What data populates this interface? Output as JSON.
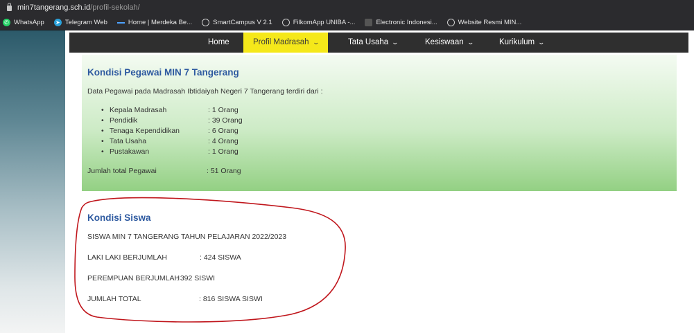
{
  "browser": {
    "url_host": "min7tangerang.sch.id",
    "url_path": "/profil-sekolah/",
    "bookmarks": [
      {
        "label": "WhatsApp",
        "icon": "whatsapp-icon"
      },
      {
        "label": "Telegram Web",
        "icon": "telegram-icon"
      },
      {
        "label": "Home | Merdeka Be...",
        "icon": "merdeka-icon"
      },
      {
        "label": "SmartCampus V 2.1",
        "icon": "globe-icon"
      },
      {
        "label": "FilkomApp UNIBA -...",
        "icon": "globe-icon"
      },
      {
        "label": "Electronic Indonesi...",
        "icon": "blank-page-icon"
      },
      {
        "label": "Website Resmi MIN...",
        "icon": "globe-icon"
      }
    ]
  },
  "nav": {
    "items": [
      {
        "label": "Home"
      },
      {
        "label": "Profil Madrasah",
        "active": true
      },
      {
        "label": "Tata Usaha"
      },
      {
        "label": "Kesiswaan"
      },
      {
        "label": "Kurikulum"
      }
    ],
    "active_color": "#f5e81a"
  },
  "pegawai": {
    "title": "Kondisi Pegawai MIN 7 Tangerang",
    "intro": "Data Pegawai pada Madrasah Ibtidaiyah Negeri 7 Tangerang terdiri dari :",
    "items": [
      {
        "label": "Kepala Madrasah",
        "value": ": 1 Orang"
      },
      {
        "label": "Pendidik",
        "value": ": 39 Orang"
      },
      {
        "label": "Tenaga Kependidikan",
        "value": ": 6 Orang"
      },
      {
        "label": "Tata Usaha",
        "value": ": 4 Orang"
      },
      {
        "label": "Pustakawan",
        "value": ": 1 Orang"
      }
    ],
    "total_label": "Jumlah total Pegawai",
    "total_value": ": 51 Orang"
  },
  "siswa": {
    "title": "Kondisi Siswa",
    "heading": "SISWA MIN 7 TANGERANG TAHUN PELAJARAN 2022/2023",
    "laki_label": "LAKI LAKI BERJUMLAH",
    "laki_value": ": 424 SISWA",
    "perempuan_label": "PEREMPUAN BERJUMLAH",
    "perempuan_value": ": 392 SISWI",
    "total_label": "JUMLAH TOTAL",
    "total_value": ": 816 SISWA SISWI"
  },
  "colors": {
    "title_blue": "#2e5aa0",
    "annotation_red": "#c0161c"
  }
}
